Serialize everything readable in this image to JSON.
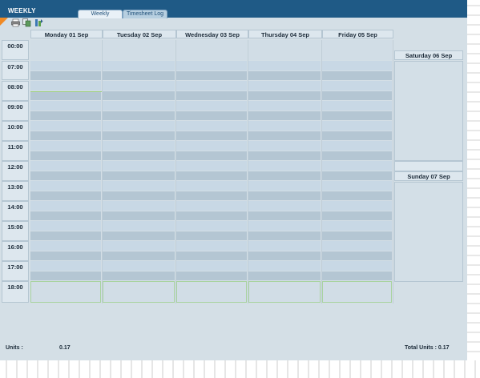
{
  "app": {
    "title": "WEEKLY"
  },
  "tabs": [
    {
      "label": "Weekly"
    },
    {
      "label": "Timesheet Log"
    }
  ],
  "toolbar": {
    "icons": [
      "print-icon",
      "copy-icon",
      "export-icon"
    ]
  },
  "weekdays": [
    {
      "label": "Monday 01 Sep"
    },
    {
      "label": "Tuesday 02 Sep"
    },
    {
      "label": "Wednesday 03 Sep"
    },
    {
      "label": "Thursday 04 Sep"
    },
    {
      "label": "Friday 05 Sep"
    }
  ],
  "weekend": [
    {
      "label": "Saturday 06 Sep"
    },
    {
      "label": "Sunday 07 Sep"
    }
  ],
  "hours": [
    "00:00",
    "07:00",
    "08:00",
    "09:00",
    "10:00",
    "11:00",
    "12:00",
    "13:00",
    "14:00",
    "15:00",
    "16:00",
    "17:00",
    "18:00"
  ],
  "footer": {
    "units_label": "Units :",
    "units_value": "0.17",
    "total_units": "Total Units : 0.17"
  },
  "colors": {
    "titlebar": "#1f5a86",
    "accent": "#f08a24",
    "background": "#d4dfe6"
  }
}
